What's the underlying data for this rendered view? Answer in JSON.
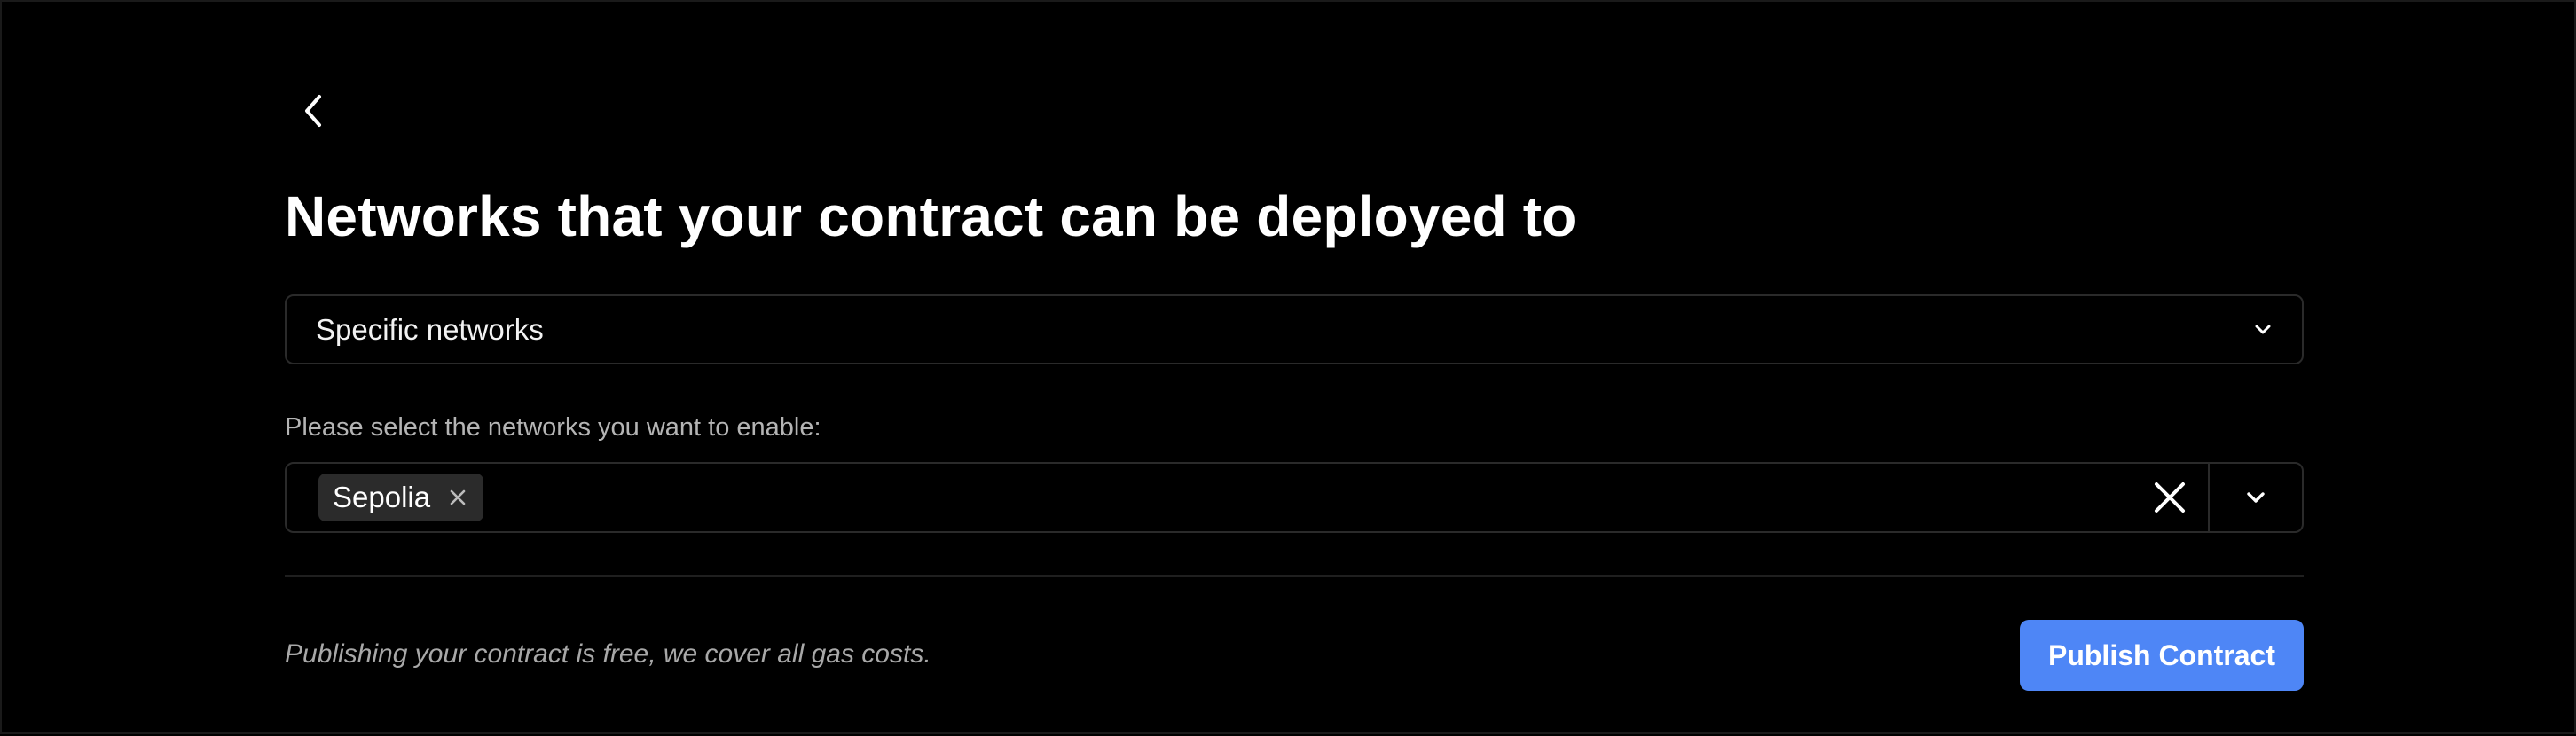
{
  "header": {
    "back_icon": "chevron-left-icon",
    "title": "Networks that your contract can be deployed to"
  },
  "deployment_select": {
    "value": "Specific networks",
    "chevron_icon": "chevron-down-icon"
  },
  "networks_field": {
    "label": "Please select the networks you want to enable:",
    "tags": [
      {
        "label": "Sepolia",
        "remove_icon": "close-icon"
      }
    ],
    "clear_icon": "close-icon",
    "toggle_icon": "chevron-down-icon"
  },
  "footer": {
    "note": "Publishing your contract is free, we cover all gas costs.",
    "publish_label": "Publish Contract"
  },
  "colors": {
    "background": "#000000",
    "border": "#2a2a2a",
    "tag_background": "#2b2b2b",
    "muted_text": "#b4b4b4",
    "accent": "#4e86f6"
  }
}
